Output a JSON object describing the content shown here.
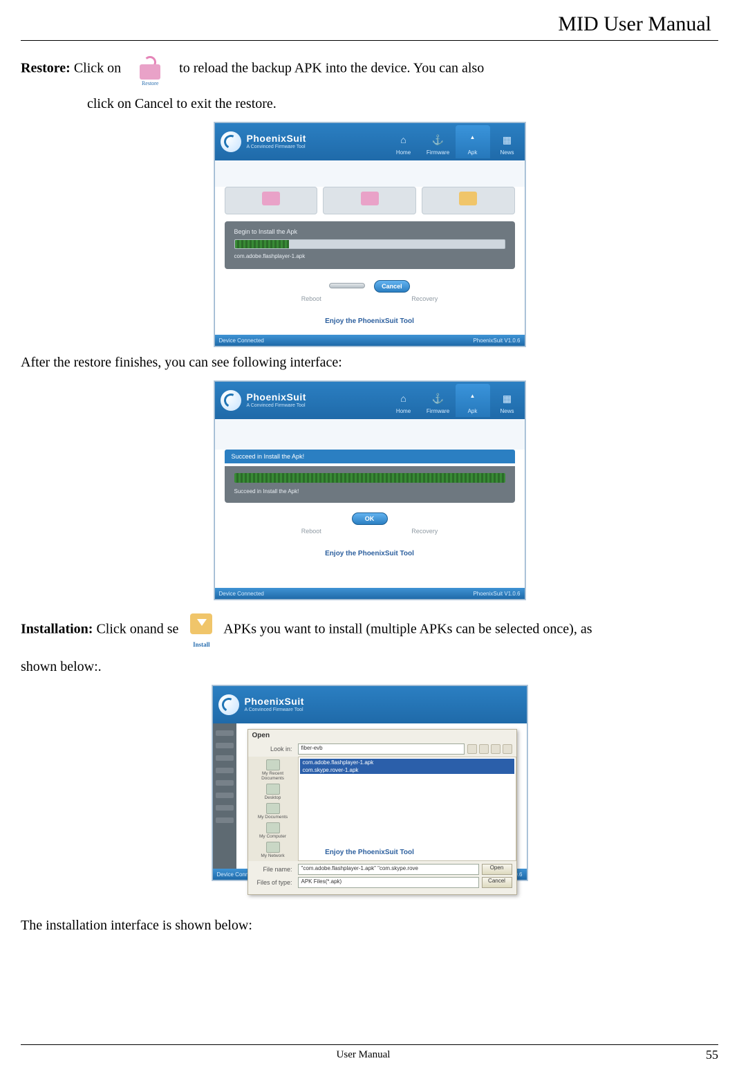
{
  "header": {
    "title": "MID User Manual"
  },
  "text": {
    "restore_label": "Restore:",
    "restore_line1": "Click on",
    "restore_line2": "to reload the backup APK into the device. You can also",
    "restore_line3": "click on Cancel to exit the restore.",
    "after_restore": "After the restore finishes, you can see following interface:",
    "install_label": "Installation:",
    "install_line1": "Click on",
    "install_line2": "and se",
    "install_line3": "APKs you want to install (multiple APKs can be selected once), as",
    "install_line4": "shown below:.",
    "install_final": "The installation interface is shown below:",
    "restore_icon_caption": "Restore",
    "install_icon_caption": "Install"
  },
  "phoenix": {
    "brand_name": "PhoenixSuit",
    "brand_sub": "A Convinced Firmware Tool",
    "nav": {
      "home": "Home",
      "firmware": "Firmware",
      "apk": "Apk",
      "news": "News"
    },
    "winctrl": {
      "help": "?",
      "min": "–",
      "close": "×"
    },
    "footer_left": "Device Connected",
    "footer_right": "PhoenixSuit V1.0.6",
    "enjoy": "Enjoy the PhoenixSuit Tool",
    "labels": {
      "reboot": "Reboot",
      "recovery": "Recovery"
    },
    "cancel_btn": "Cancel",
    "ok_btn": "OK",
    "blank_btn": ""
  },
  "shot1": {
    "panel_title": "Begin to Install the Apk",
    "apk_file": "com.adobe.flashplayer-1.apk"
  },
  "shot2": {
    "banner": "Succeed in Install the Apk!",
    "below": "Succeed in Install the Apk!"
  },
  "shot3": {
    "open_title": "Open",
    "lookin_label": "Look in:",
    "lookin_value": "fiber-evb",
    "places": {
      "recent": "My Recent Documents",
      "desktop": "Desktop",
      "mydocs": "My Documents",
      "mycomp": "My Computer",
      "mynet": "My Network"
    },
    "files": {
      "f1": "com.adobe.flashplayer-1.apk",
      "f2": "com.skype.rover-1.apk"
    },
    "filename_label": "File name:",
    "filename_value": "\"com.adobe.flashplayer-1.apk\" \"com.skype.rove",
    "filetype_label": "Files of type:",
    "filetype_value": "APK Files(*.apk)",
    "open_btn": "Open",
    "cancel_btn": "Cancel"
  },
  "footer": {
    "center": "User Manual",
    "page": "55"
  }
}
